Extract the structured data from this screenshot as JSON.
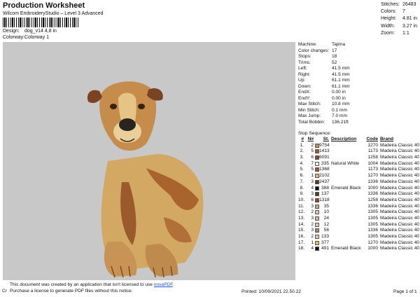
{
  "header": {
    "title": "Production Worksheet",
    "subtitle": "Wilcom EmbroideryStudio – Level 3 Advanced",
    "design_label": "Design:",
    "design_value": "dog_v14 4,8 in",
    "colorway_label": "Colorway:",
    "colorway_value": "Colorway 1"
  },
  "stats": [
    {
      "label": "Stitches:",
      "value": "26483"
    },
    {
      "label": "Colors:",
      "value": "7"
    },
    {
      "label": "Height:",
      "value": "4.81 in"
    },
    {
      "label": "Width:",
      "value": "3.27 in"
    },
    {
      "label": "Zoom:",
      "value": "1:1"
    }
  ],
  "machine_info": [
    {
      "label": "Machine:",
      "value": "Tajima"
    },
    {
      "label": "Color changes:",
      "value": "17"
    },
    {
      "label": "Stops:",
      "value": "18"
    },
    {
      "label": "Trims:",
      "value": "52"
    },
    {
      "label": "Left:",
      "value": "41.5 mm"
    },
    {
      "label": "Right:",
      "value": "41.5 mm"
    },
    {
      "label": "Up:",
      "value": "61.1 mm"
    },
    {
      "label": "Down:",
      "value": "61.1 mm"
    },
    {
      "label": "EndX:",
      "value": "0.00 in"
    },
    {
      "label": "EndY:",
      "value": "0.00 in"
    },
    {
      "label": "Max Stitch:",
      "value": "10.8 mm"
    },
    {
      "label": "Min Stitch:",
      "value": "0.1 mm"
    },
    {
      "label": "Max Jump:",
      "value": "7.0 mm"
    },
    {
      "label": "Total Bobbin:",
      "value": "136.21ft"
    }
  ],
  "sequence": {
    "title": "Stop Sequence:",
    "headers": {
      "stop": "#",
      "n": "N#",
      "st": "St.",
      "desc": "Description",
      "code": "Code",
      "brand": "Brand"
    },
    "rows": [
      {
        "stop": "1.",
        "n": "2",
        "st": "9754",
        "desc": "",
        "code": "1270",
        "brand": "Madeira Classic 40",
        "color": "#c98a4b"
      },
      {
        "stop": "2.",
        "n": "5",
        "st": "1413",
        "desc": "",
        "code": "1173",
        "brand": "Madeira Classic 40",
        "color": "#a8542a"
      },
      {
        "stop": "3.",
        "n": "6",
        "st": "6091",
        "desc": "",
        "code": "1258",
        "brand": "Madeira Classic 40",
        "color": "#8a4a2a"
      },
      {
        "stop": "4.",
        "n": "7",
        "st": "335",
        "desc": "Natural White",
        "code": "1004",
        "brand": "Madeira Classic 40",
        "color": "#f4f2ea"
      },
      {
        "stop": "5.",
        "n": "5",
        "st": "1368",
        "desc": "",
        "code": "1173",
        "brand": "Madeira Classic 40",
        "color": "#a8542a"
      },
      {
        "stop": "6.",
        "n": "1",
        "st": "2102",
        "desc": "",
        "code": "1270",
        "brand": "Madeira Classic 40",
        "color": "#e0b86a"
      },
      {
        "stop": "7.",
        "n": "3",
        "st": "2437",
        "desc": "",
        "code": "1336",
        "brand": "Madeira Classic 40",
        "color": "#4a3a30"
      },
      {
        "stop": "8.",
        "n": "4",
        "st": "388",
        "desc": "Emerald Black",
        "code": "1000",
        "brand": "Madeira Classic 40",
        "color": "#111111"
      },
      {
        "stop": "9.",
        "n": "3",
        "st": "137",
        "desc": "",
        "code": "1336",
        "brand": "Madeira Classic 40",
        "color": "#4a3a30"
      },
      {
        "stop": "10.",
        "n": "6",
        "st": "1318",
        "desc": "",
        "code": "1258",
        "brand": "Madeira Classic 40",
        "color": "#8a4a2a"
      },
      {
        "stop": "11.",
        "n": "3",
        "st": "35",
        "desc": "",
        "code": "1336",
        "brand": "Madeira Classic 40",
        "color": "#b8a898"
      },
      {
        "stop": "12.",
        "n": "2",
        "st": "10",
        "desc": "",
        "code": "1305",
        "brand": "Madeira Classic 40",
        "color": "#d8c8b0"
      },
      {
        "stop": "13.",
        "n": "3",
        "st": "24",
        "desc": "",
        "code": "1305",
        "brand": "Madeira Classic 40",
        "color": "#c8b8a0"
      },
      {
        "stop": "14.",
        "n": "2",
        "st": "12",
        "desc": "",
        "code": "1305",
        "brand": "Madeira Classic 40",
        "color": "#d8c8b0"
      },
      {
        "stop": "15.",
        "n": "3",
        "st": "56",
        "desc": "",
        "code": "1336",
        "brand": "Madeira Classic 40",
        "color": "#9a8878"
      },
      {
        "stop": "16.",
        "n": "2",
        "st": "133",
        "desc": "",
        "code": "1305",
        "brand": "Madeira Classic 40",
        "color": "#d8c8b0"
      },
      {
        "stop": "17.",
        "n": "1",
        "st": "377",
        "desc": "",
        "code": "1270",
        "brand": "Madeira Classic 40",
        "color": "#e0b86a"
      },
      {
        "stop": "18.",
        "n": "4",
        "st": "491",
        "desc": "Emerald Black",
        "code": "1000",
        "brand": "Madeira Classic 40",
        "color": "#111111"
      }
    ]
  },
  "notice": {
    "line1_pre": "This document was created by an application that isn't licensed to use ",
    "link": "novaPDF",
    "line1_post": ".",
    "line2": "Purchase a license to generate PDF files without this notice."
  },
  "footer": {
    "cr": "Cr",
    "printed": "Printed: 10/09/2021 22.50.22",
    "page": "Page 1 of 1"
  },
  "design_preview": {
    "background": "#c8c8c8"
  }
}
